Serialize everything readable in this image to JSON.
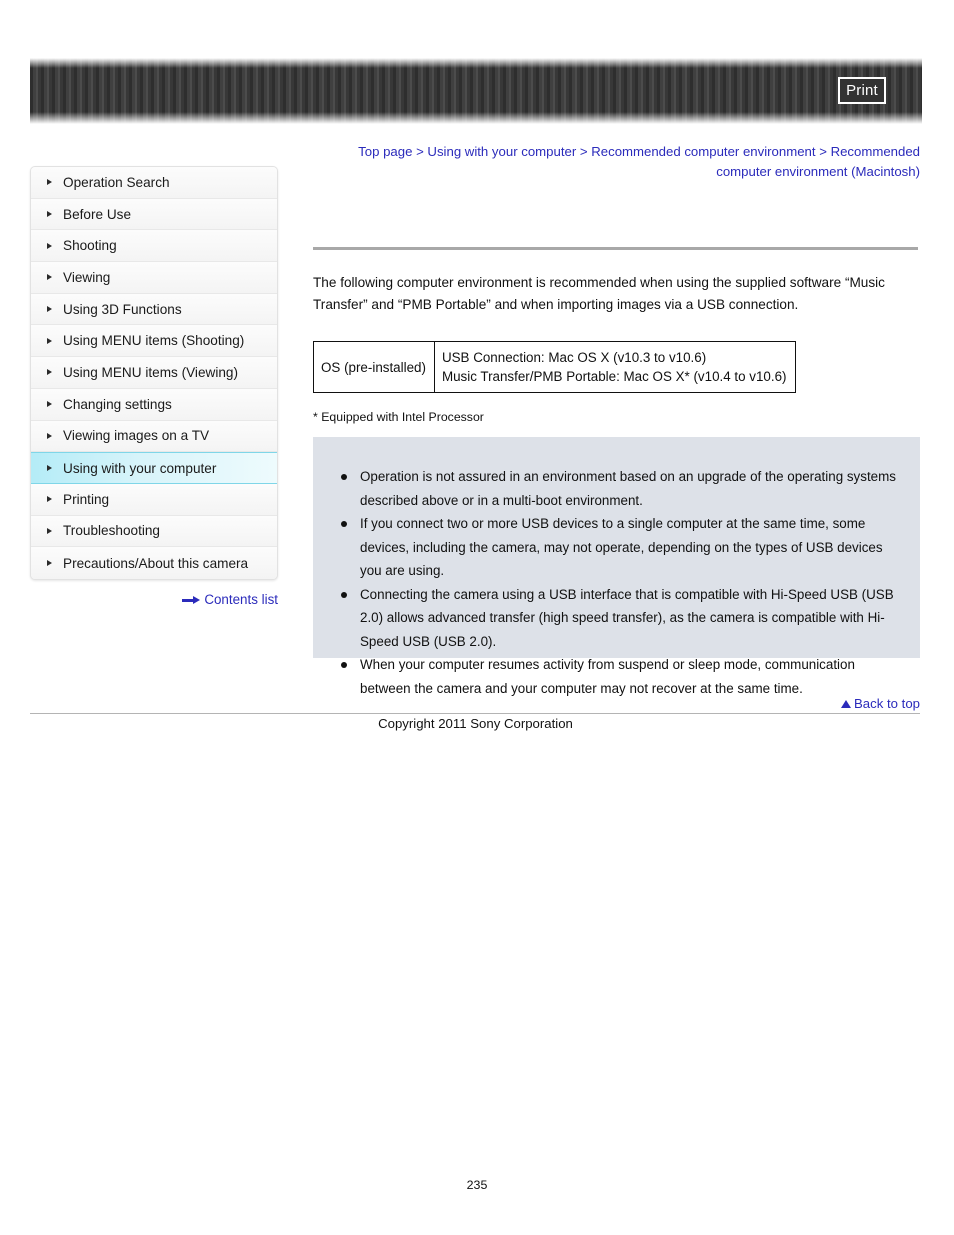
{
  "header": {
    "print_label": "Print"
  },
  "breadcrumb": {
    "text": "Top page > Using with your computer > Recommended computer environment > Recommended computer environment (Macintosh)"
  },
  "sidebar": {
    "items": [
      {
        "label": "Operation Search",
        "active": false
      },
      {
        "label": "Before Use",
        "active": false
      },
      {
        "label": "Shooting",
        "active": false
      },
      {
        "label": "Viewing",
        "active": false
      },
      {
        "label": "Using 3D Functions",
        "active": false
      },
      {
        "label": "Using MENU items (Shooting)",
        "active": false
      },
      {
        "label": "Using MENU items (Viewing)",
        "active": false
      },
      {
        "label": "Changing settings",
        "active": false
      },
      {
        "label": "Viewing images on a TV",
        "active": false
      },
      {
        "label": "Using with your computer",
        "active": true
      },
      {
        "label": "Printing",
        "active": false
      },
      {
        "label": "Troubleshooting",
        "active": false
      },
      {
        "label": "Precautions/About this camera",
        "active": false
      }
    ],
    "contents_list_label": "Contents list"
  },
  "main": {
    "intro": "The following computer environment is recommended when using the supplied software “Music Transfer” and “PMB Portable” and when importing images via a USB connection.",
    "table": {
      "row_label": "OS (pre-installed)",
      "value_line_1": "USB Connection: Mac OS X (v10.3 to v10.6)",
      "value_line_2": "Music Transfer/PMB Portable: Mac OS X* (v10.4 to v10.6)"
    },
    "footnote": "* Equipped with Intel Processor",
    "notes": [
      "Operation is not assured in an environment based on an upgrade of the operating systems described above or in a multi-boot environment.",
      "If you connect two or more USB devices to a single computer at the same time, some devices, including the camera, may not operate, depending on the types of USB devices you are using.",
      "Connecting the camera using a USB interface that is compatible with Hi-Speed USB (USB 2.0) allows advanced transfer (high speed transfer), as the camera is compatible with Hi-Speed USB (USB 2.0).",
      "When your computer resumes activity from suspend or sleep mode, communication between the camera and your computer may not recover at the same time."
    ]
  },
  "footer": {
    "back_to_top_label": "Back to top",
    "copyright": "Copyright 2011 Sony Corporation",
    "page_number": "235"
  },
  "colors": {
    "link_blue": "#2b2bbb",
    "active_nav_cyan": "#b4ecf7",
    "note_box_gray": "#dde1e8",
    "banner_dark": "#3a3a3a"
  }
}
